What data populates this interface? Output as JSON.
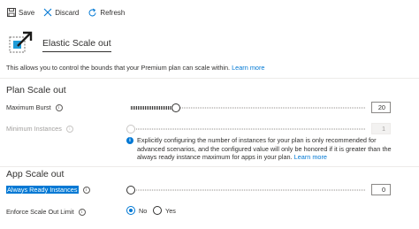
{
  "toolbar": {
    "save_label": "Save",
    "discard_label": "Discard",
    "refresh_label": "Refresh"
  },
  "header": {
    "title": "Elastic Scale out",
    "icon": "scale-out-icon"
  },
  "description": {
    "text": "This allows you to control the bounds that your Premium plan can scale within.",
    "link": "Learn more"
  },
  "plan_scale_out": {
    "heading": "Plan Scale out",
    "maximum_burst": {
      "label": "Maximum Burst",
      "value": "20",
      "slider_fraction": 0.2
    },
    "minimum_instances": {
      "label": "Minimum Instances",
      "value": "1",
      "slider_fraction": 0.0,
      "disabled": true
    },
    "info": {
      "text": "Explicitly configuring the number of instances for your plan is only recommended for advanced scenarios, and the configured value will only be honored if it is greater than the always ready instance maximum for apps in your plan.",
      "link": "Learn more"
    }
  },
  "app_scale_out": {
    "heading": "App Scale out",
    "always_ready_instances": {
      "label": "Always Ready Instances",
      "value": "0",
      "slider_fraction": 0.0
    },
    "enforce_scale_out_limit": {
      "label": "Enforce Scale Out Limit",
      "options": [
        "No",
        "Yes"
      ],
      "selected": "No"
    }
  },
  "colors": {
    "accent": "#0078d4",
    "text": "#323130",
    "disabled": "#a19f9d"
  }
}
